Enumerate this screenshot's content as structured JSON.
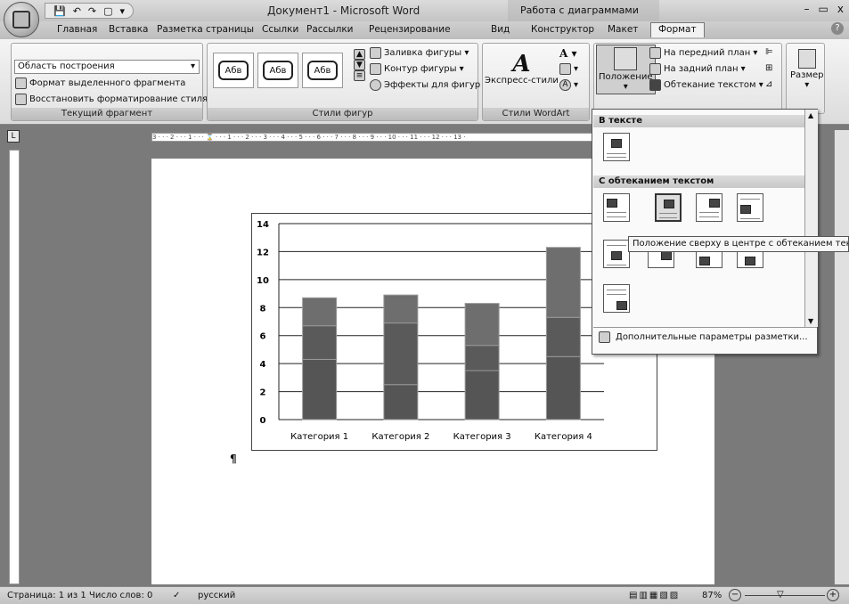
{
  "window": {
    "title": "Документ1 - Microsoft Word",
    "context_tools": "Работа с диаграммами",
    "controls": [
      "–",
      "▭",
      "x"
    ]
  },
  "qat": [
    "💾",
    "↶",
    "↷",
    "▢",
    "▾"
  ],
  "tabs": [
    "Главная",
    "Вставка",
    "Разметка страницы",
    "Ссылки",
    "Рассылки",
    "Рецензирование",
    "Вид",
    "Конструктор",
    "Макет",
    "Формат"
  ],
  "active_tab": "Формат",
  "ribbon": {
    "current_fragment": {
      "dropdown_value": "Область построения",
      "format_selection": "Формат выделенного фрагмента",
      "reset_style": "Восстановить форматирование стиля",
      "label": "Текущий фрагмент"
    },
    "shape_styles": {
      "samples": [
        "Абв",
        "Абв",
        "Абв"
      ],
      "fill": "Заливка фигуры ▾",
      "outline": "Контур фигуры ▾",
      "effects": "Эффекты для фигур ▾",
      "label": "Стили фигур"
    },
    "wordart": {
      "express_styles": "Экспресс-стили",
      "label": "Стили WordArt"
    },
    "arrange": {
      "position": "Положение",
      "bring_front": "На передний план ▾",
      "send_back": "На задний план ▾",
      "text_wrap": "Обтекание текстом ▾"
    },
    "size": {
      "label": "Размер"
    }
  },
  "ruler_text": "3 · · · 2 · · · 1 · · · ⌛ · · · 1 · · · 2 · · · 3 · · · 4 · · · 5 · · · 6 · · · 7 · · · 8 · · · 9 · · · 10 · · · 11 · · · 12 · · · 13 ·",
  "position_panel": {
    "section_inline": "В тексте",
    "section_wrap": "С обтеканием текстом",
    "footer": "Дополнительные параметры разметки...",
    "tooltip": "Положение сверху в центре с обтеканием текста в квадрат"
  },
  "chart_data": {
    "type": "bar",
    "stacked": true,
    "categories": [
      "Категория 1",
      "Категория 2",
      "Категория 3",
      "Категория 4"
    ],
    "series": [
      {
        "values": [
          4.3,
          2.5,
          3.5,
          4.5
        ]
      },
      {
        "values": [
          2.4,
          4.4,
          1.8,
          2.8
        ]
      },
      {
        "values": [
          2.0,
          2.0,
          3.0,
          5.0
        ]
      }
    ],
    "ylim": [
      0,
      14
    ],
    "yticks": [
      0,
      2,
      4,
      6,
      8,
      10,
      12,
      14
    ],
    "grid": true,
    "colors": [
      "#555555",
      "#5a5a5a",
      "#6e6e6e"
    ]
  },
  "statusbar": {
    "page": "Страница: 1 из 1",
    "words": "Число слов: 0",
    "language": "русский",
    "zoom": "87%"
  }
}
